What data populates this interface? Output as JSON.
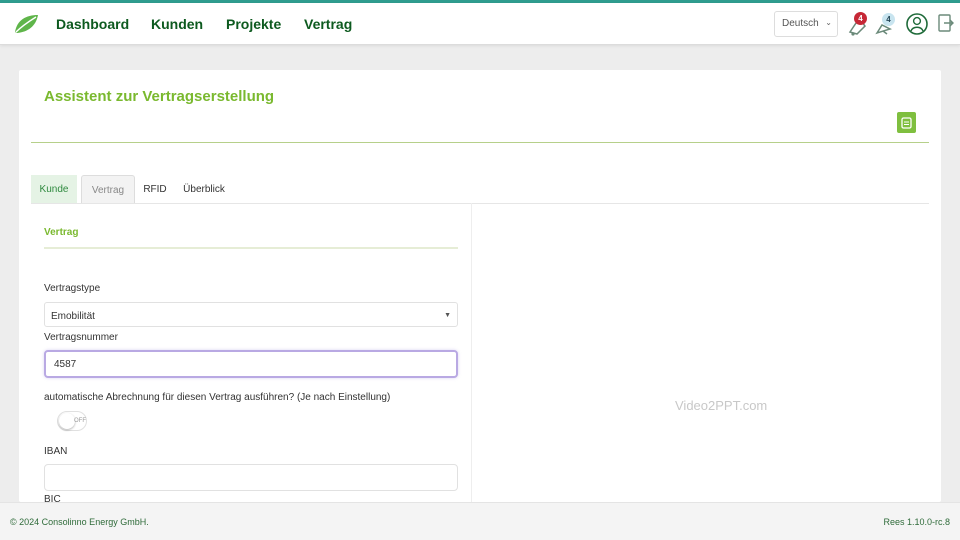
{
  "nav": {
    "links": [
      "Dashboard",
      "Kunden",
      "Projekte",
      "Vertrag"
    ],
    "language": "Deutsch",
    "notifications_count": "4",
    "alerts_count": "4"
  },
  "page": {
    "title": "Assistent zur Vertragserstellung",
    "tabs": [
      "Kunde",
      "Vertrag",
      "RFID",
      "Überblick"
    ],
    "active_tab": "Vertrag"
  },
  "form": {
    "section_title": "Vertrag",
    "type_label": "Vertragstype",
    "type_value": "Emobilität",
    "number_label": "Vertragsnummer",
    "number_value": "4587",
    "auto_billing_label": "automatische Abrechnung für diesen Vertrag ausführen? (Je nach Einstellung)",
    "toggle_text": "OFF",
    "iban_label": "IBAN",
    "iban_value": "",
    "bic_label": "BIC"
  },
  "watermark": "Video2PPT.com",
  "footer": {
    "copyright": "© 2024 Consolinno Energy GmbH.",
    "version": "Rees 1.10.0-rc.8"
  },
  "colors": {
    "brand_dark": "#0d5a1f",
    "accent_green": "#7ab92f",
    "badge_red": "#c62836",
    "badge_blue": "#c8e4ef",
    "focus_purple": "#b9a9e3"
  }
}
